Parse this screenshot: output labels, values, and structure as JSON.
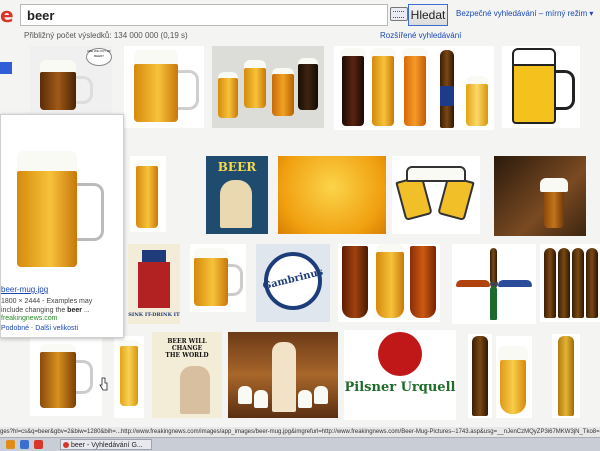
{
  "search": {
    "query": "beer",
    "button_label": "Hledat",
    "safe_search": "Bezpečné vyhledávání – mírný režim ▾",
    "results_count": "Přibližný počet výsledků: 134 000 000 (0,19 s)",
    "advanced_link": "Rozšířené vyhledávání"
  },
  "preview": {
    "filename": "beer-mug.jpg",
    "meta_prefix": "1800 × 2444 - Examples may",
    "meta_line2": "include changing the ",
    "meta_bold": "beer",
    "meta_suffix": " ...",
    "domain": "freakingnews.com",
    "similar": "Podobné",
    "separator": " - ",
    "all_sizes": "Další velikosti"
  },
  "tiles": {
    "mug_sign": "ARE WE OUT OF BEER?",
    "beer_poster": "BEER",
    "gambrinus": "Gambrinus",
    "uncle_sam": "SINK IT-DRINK IT",
    "change_world": [
      "BEER WILL",
      "CHANGE",
      "THE WORLD"
    ],
    "pilsner": "Pilsner Urquell"
  },
  "status": {
    "url": "ges?hl=cs&q=beer&gbv=2&biw=1280&bih=...http://www.freakingnews.com/images/app_images/beer-mug.jpg&imgrefurl=http://www.freakingnews.com/Beer-Mug-Pictures--1743.asp&usg=__nJenCzMQyZP3i67MKW3jN_Tko8=&h=2444&w=..."
  },
  "taskbar": {
    "active_tab": "beer - Vyhledávání G..."
  },
  "colors": {
    "link": "#1a48b8",
    "logo_red": "#d8362a",
    "beer_gold": "#f2b52a",
    "button_border": "#3b6ed1"
  },
  "icons": [
    "keyboard-icon",
    "mouse-cursor-icon"
  ]
}
